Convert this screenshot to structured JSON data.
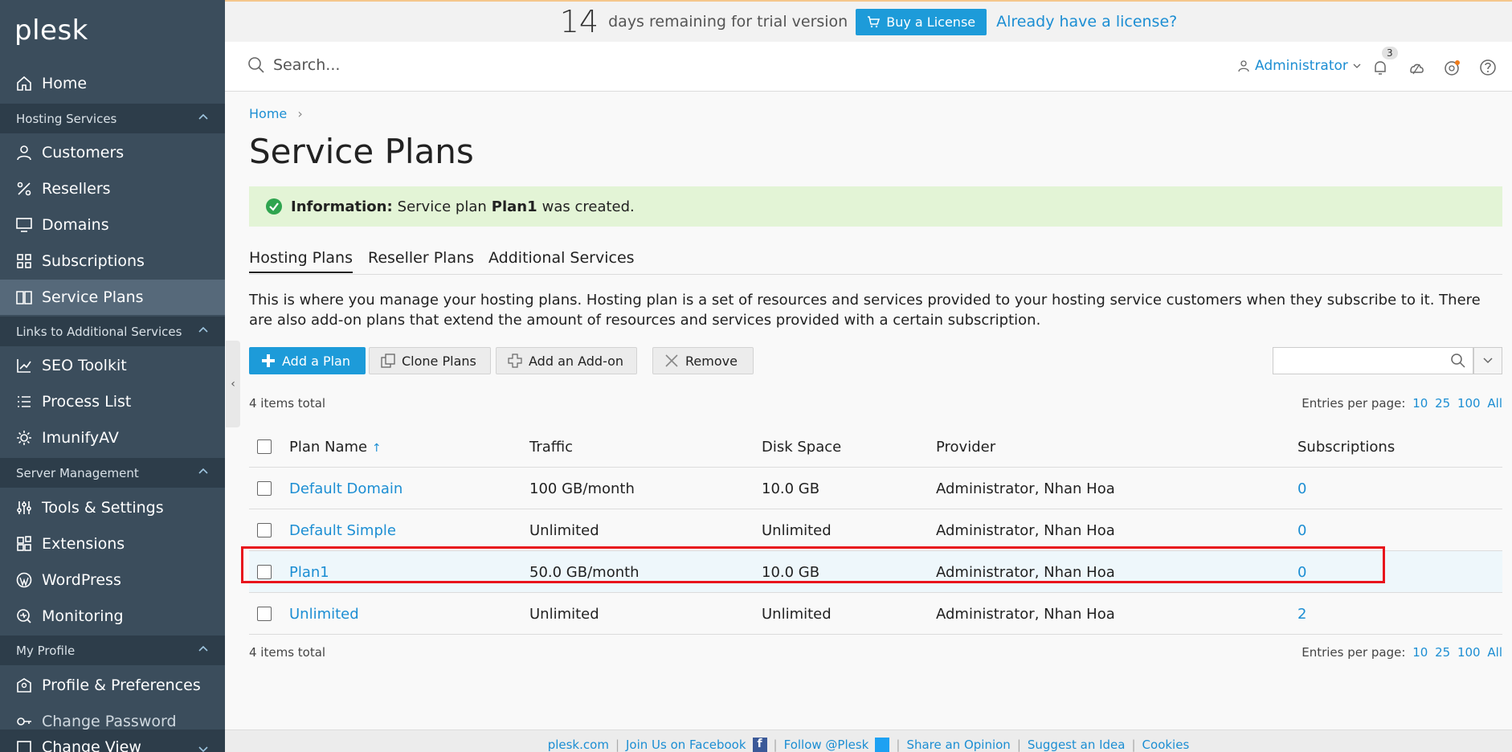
{
  "brand": {
    "logo": "plesk"
  },
  "sidebar": {
    "items": [
      {
        "label": "Home",
        "icon": "home-icon"
      },
      {
        "label": "Customers",
        "icon": "user-icon"
      },
      {
        "label": "Resellers",
        "icon": "percent-icon"
      },
      {
        "label": "Domains",
        "icon": "monitor-icon"
      },
      {
        "label": "Subscriptions",
        "icon": "grid-icon"
      },
      {
        "label": "Service Plans",
        "icon": "book-icon",
        "active": true
      },
      {
        "label": "SEO Toolkit",
        "icon": "chart-icon"
      },
      {
        "label": "Process List",
        "icon": "list-icon"
      },
      {
        "label": "ImunifyAV",
        "icon": "gear-icon"
      },
      {
        "label": "Tools & Settings",
        "icon": "sliders-icon"
      },
      {
        "label": "Extensions",
        "icon": "extensions-icon"
      },
      {
        "label": "WordPress",
        "icon": "wordpress-icon"
      },
      {
        "label": "Monitoring",
        "icon": "monitoring-icon"
      },
      {
        "label": "Profile & Preferences",
        "icon": "profile-icon"
      },
      {
        "label": "Change Password",
        "icon": "key-icon"
      },
      {
        "label": "Change View",
        "icon": "view-icon"
      }
    ],
    "sections": [
      "Hosting Services",
      "Links to Additional Services",
      "Server Management",
      "My Profile"
    ]
  },
  "trial": {
    "days": "14",
    "text": "days remaining for trial version",
    "buy_label": "Buy a License",
    "already_label": "Already have a license?"
  },
  "topbar": {
    "search_placeholder": "Search...",
    "user": "Administrator",
    "notifications_count": "3"
  },
  "breadcrumb": {
    "home": "Home"
  },
  "page": {
    "title": "Service Plans",
    "info_label": "Information:",
    "info_text_1": "Service plan",
    "info_plan": "Plan1",
    "info_text_2": "was created.",
    "description": "This is where you manage your hosting plans. Hosting plan is a set of resources and services provided to your hosting service customers when they subscribe to it. There are also add-on plans that extend the amount of resources and services provided with a certain subscription."
  },
  "tabs": [
    "Hosting Plans",
    "Reseller Plans",
    "Additional Services"
  ],
  "toolbar": {
    "add_plan": "Add a Plan",
    "clone_plans": "Clone Plans",
    "add_addon": "Add an Add-on",
    "remove": "Remove"
  },
  "list": {
    "items_total": "4 items total",
    "entries_label": "Entries per page:",
    "entries_options": [
      "10",
      "25",
      "100",
      "All"
    ],
    "columns": [
      "Plan Name",
      "Traffic",
      "Disk Space",
      "Provider",
      "Subscriptions"
    ],
    "sort_indicator": "↑",
    "rows": [
      {
        "name": "Default Domain",
        "traffic": "100 GB/month",
        "disk": "10.0 GB",
        "provider": "Administrator, Nhan Hoa",
        "subscriptions": "0"
      },
      {
        "name": "Default Simple",
        "traffic": "Unlimited",
        "disk": "Unlimited",
        "provider": "Administrator, Nhan Hoa",
        "subscriptions": "0"
      },
      {
        "name": "Plan1",
        "traffic": "50.0 GB/month",
        "disk": "10.0 GB",
        "provider": "Administrator, Nhan Hoa",
        "subscriptions": "0",
        "highlighted": true
      },
      {
        "name": "Unlimited",
        "traffic": "Unlimited",
        "disk": "Unlimited",
        "provider": "Administrator, Nhan Hoa",
        "subscriptions": "2"
      }
    ]
  },
  "footer": {
    "links": [
      "plesk.com",
      "Join Us on Facebook",
      "Follow @Plesk",
      "Share an Opinion",
      "Suggest an Idea",
      "Cookies"
    ]
  },
  "colors": {
    "accent": "#1d9bd9",
    "sidebar": "#3b4d5c",
    "success_bg": "#e3f4d6",
    "highlight_border": "#e8141c"
  }
}
